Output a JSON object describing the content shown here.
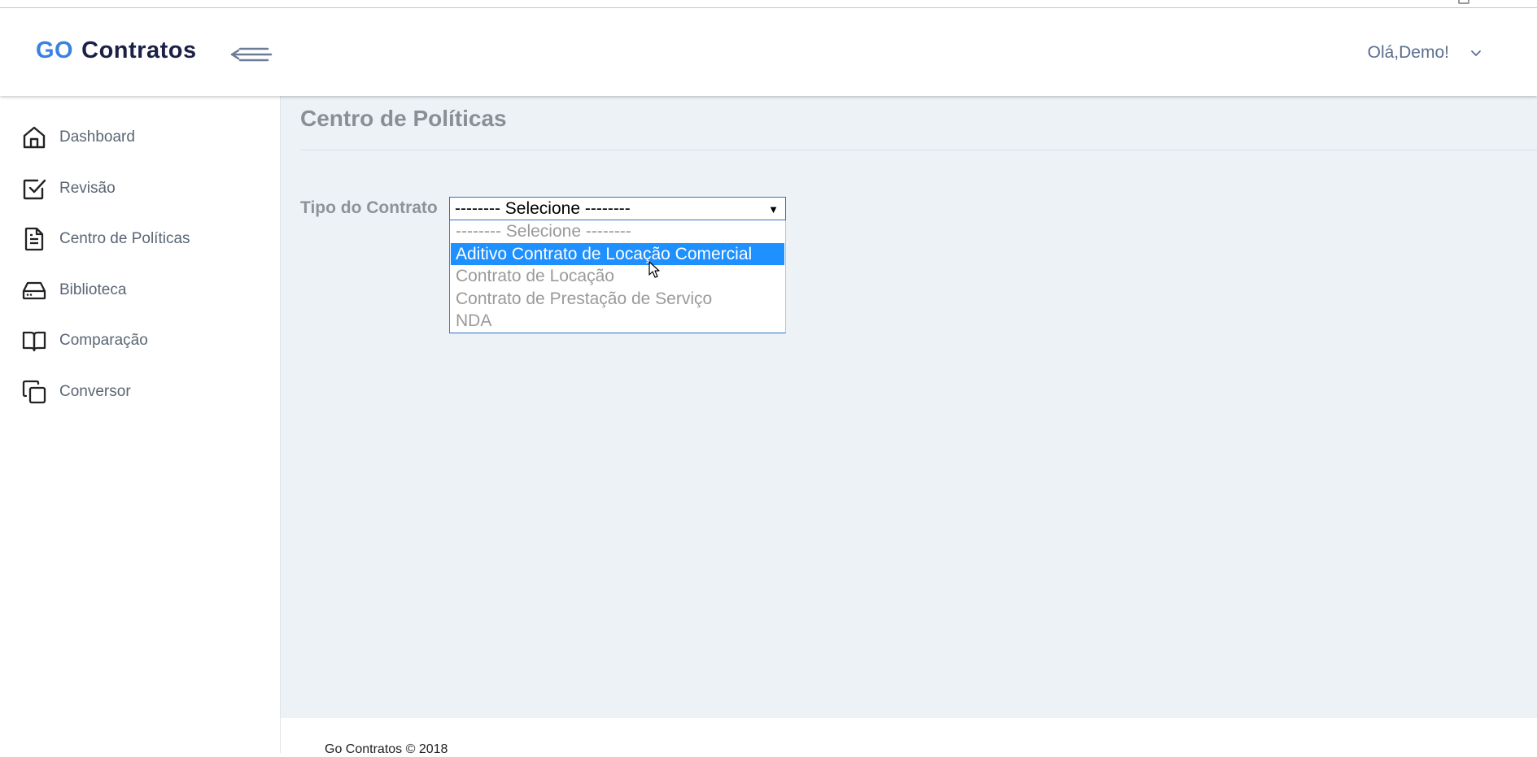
{
  "header": {
    "logo_go": "GO",
    "logo_brand": "Contratos",
    "user_greeting": "Olá,Demo!"
  },
  "sidebar": {
    "items": [
      {
        "label": "Dashboard",
        "icon": "home-icon"
      },
      {
        "label": "Revisão",
        "icon": "check-square-icon"
      },
      {
        "label": "Centro de Políticas",
        "icon": "document-icon"
      },
      {
        "label": "Biblioteca",
        "icon": "hard-drive-icon"
      },
      {
        "label": "Comparação",
        "icon": "book-open-icon"
      },
      {
        "label": "Conversor",
        "icon": "copy-icon"
      }
    ]
  },
  "main": {
    "title": "Centro de Políticas",
    "contract_type_label": "Tipo do Contrato",
    "select": {
      "selected_value": "-------- Selecione --------",
      "options": [
        "-------- Selecione --------",
        "Aditivo Contrato de Locação Comercial",
        "Contrato de Locação",
        "Contrato de Prestação de Serviço",
        "NDA"
      ],
      "highlighted_index": 1
    }
  },
  "footer": {
    "text": "Go Contratos © 2018"
  },
  "colors": {
    "accent": "#3b82e0",
    "brand_dark": "#1b2145",
    "highlight": "#1e90ff",
    "main_bg": "#ecf2f6"
  }
}
